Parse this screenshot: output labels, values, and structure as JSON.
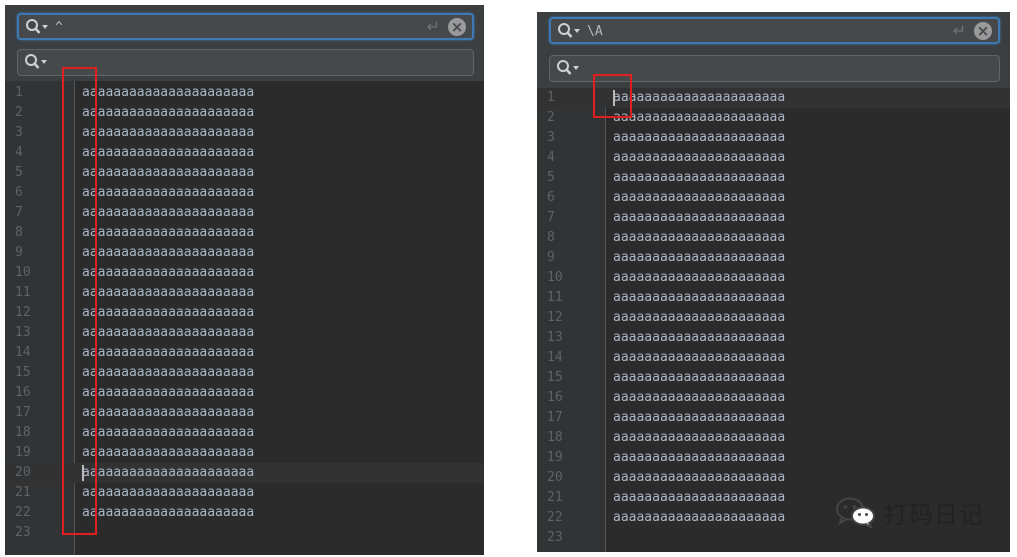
{
  "left": {
    "search_query": "^",
    "replace_query": "",
    "line_text": "aaaaaaaaaaaaaaaaaaaaaa",
    "line_numbers": [
      "1",
      "2",
      "3",
      "4",
      "5",
      "6",
      "7",
      "8",
      "9",
      "10",
      "11",
      "12",
      "13",
      "14",
      "15",
      "16",
      "17",
      "18",
      "19",
      "20",
      "21",
      "22",
      "23"
    ],
    "current_line": "20"
  },
  "right": {
    "search_query": "\\A",
    "replace_query": "",
    "line_text": "aaaaaaaaaaaaaaaaaaaaaa",
    "line_numbers": [
      "1",
      "2",
      "3",
      "4",
      "5",
      "6",
      "7",
      "8",
      "9",
      "10",
      "11",
      "12",
      "13",
      "14",
      "15",
      "16",
      "17",
      "18",
      "19",
      "20",
      "21",
      "22",
      "23"
    ],
    "current_line": "1"
  },
  "icons": {
    "search": "search-icon",
    "enter": "enter-icon",
    "clear": "clear-icon"
  },
  "watermark": {
    "brand": "打码日记",
    "icon": "wechat-icon"
  },
  "colors": {
    "editor_bg": "#2b2b2b",
    "toolbar_bg": "#3c3f41",
    "focus_border": "#3d7ab5",
    "highlight": "#e02020",
    "code_text": "#a9b7c6",
    "line_number": "#606366"
  }
}
